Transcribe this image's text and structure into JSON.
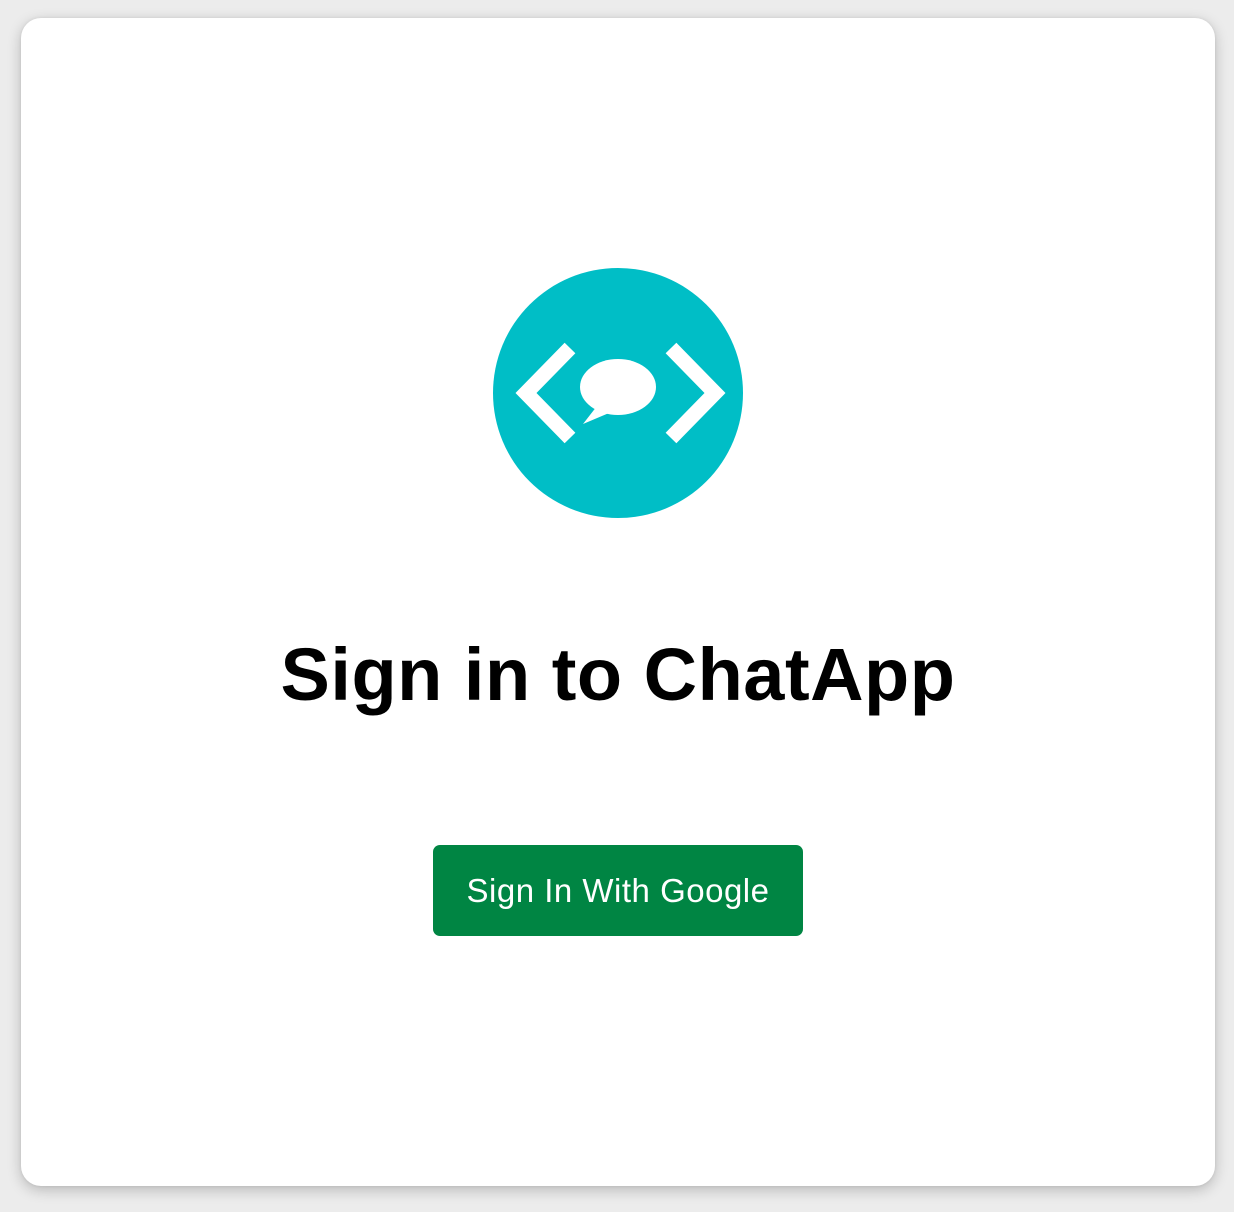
{
  "colors": {
    "background": "#ececec",
    "card": "#ffffff",
    "logo_circle": "#00bec6",
    "logo_glyph": "#ffffff",
    "title_text": "#000000",
    "button_bg": "#008543",
    "button_text": "#ffffff"
  },
  "logo": {
    "icon": "code-chat-bubble-icon"
  },
  "page": {
    "title": "Sign in to ChatApp"
  },
  "auth": {
    "google_button_label": "Sign In With Google"
  }
}
